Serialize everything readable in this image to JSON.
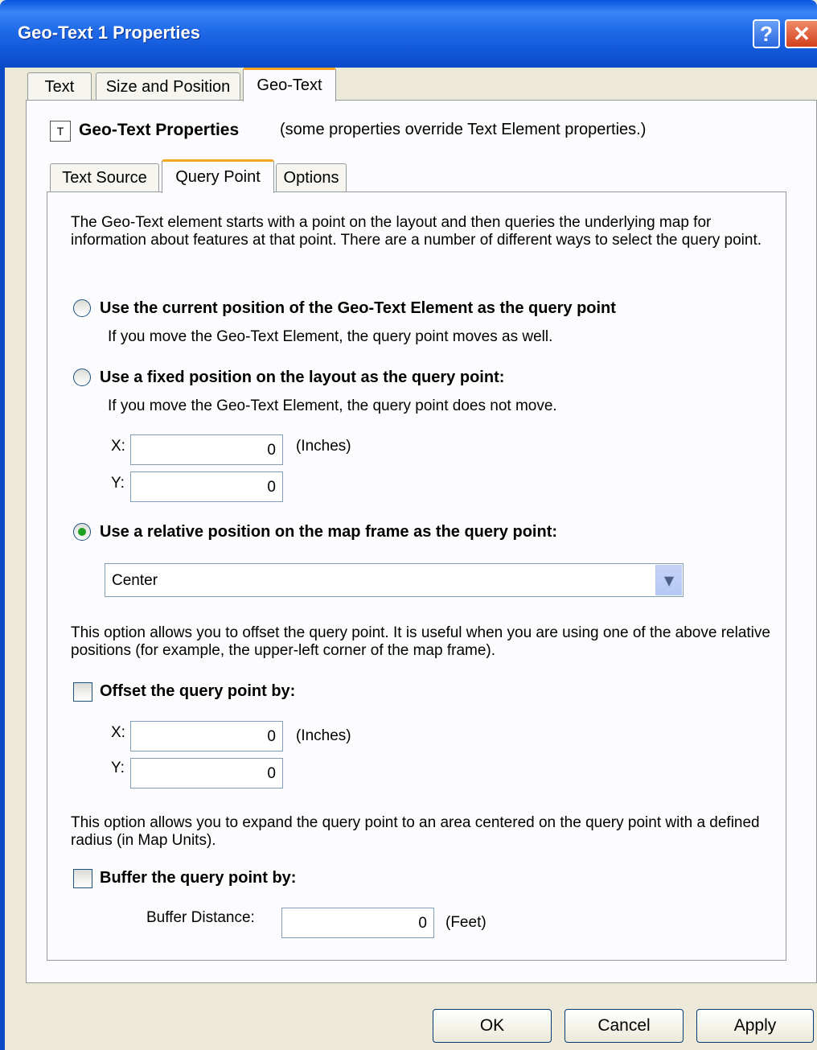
{
  "window": {
    "title": "Geo-Text 1 Properties",
    "help_label": "?",
    "close_label": "✕"
  },
  "tabs": [
    "Text",
    "Size and Position",
    "Geo-Text"
  ],
  "header": {
    "icon_label": "T",
    "title": "Geo-Text Properties",
    "note": "(some properties override Text Element properties.)"
  },
  "subtabs": [
    "Text Source",
    "Query Point",
    "Options"
  ],
  "intro": "The Geo-Text element starts with a point on the layout and then queries the underlying map for information about features at that point. There are a number of different ways to select the query point.",
  "options": {
    "current": {
      "label": "Use the current position of the Geo-Text Element as the query point",
      "note": "If you move the Geo-Text Element, the query point moves as well.",
      "checked": false
    },
    "fixed": {
      "label": "Use a fixed position on the layout as the query point:",
      "note": "If you move the Geo-Text Element, the query point does not move.",
      "checked": false,
      "x_label": "X:",
      "x_value": "0",
      "y_label": "Y:",
      "y_value": "0",
      "unit": "(Inches)"
    },
    "relative": {
      "label": "Use a relative position on the map frame as the query point:",
      "checked": true,
      "selected": "Center"
    }
  },
  "offset": {
    "description": "This option allows you to offset the query point.  It is useful when you are using one of the above relative positions (for example, the upper-left corner of the map frame).",
    "label": "Offset the query point by:",
    "checked": false,
    "x_label": "X:",
    "x_value": "0",
    "y_label": "Y:",
    "y_value": "0",
    "unit": "(Inches)"
  },
  "buffer": {
    "description": "This option allows you to expand the query point to an area centered on the query point with a defined radius (in Map Units).",
    "label": "Buffer the query point by:",
    "checked": false,
    "distance_label": "Buffer Distance:",
    "distance_value": "0",
    "unit": "(Feet)"
  },
  "buttons": {
    "ok": "OK",
    "cancel": "Cancel",
    "apply": "Apply"
  }
}
